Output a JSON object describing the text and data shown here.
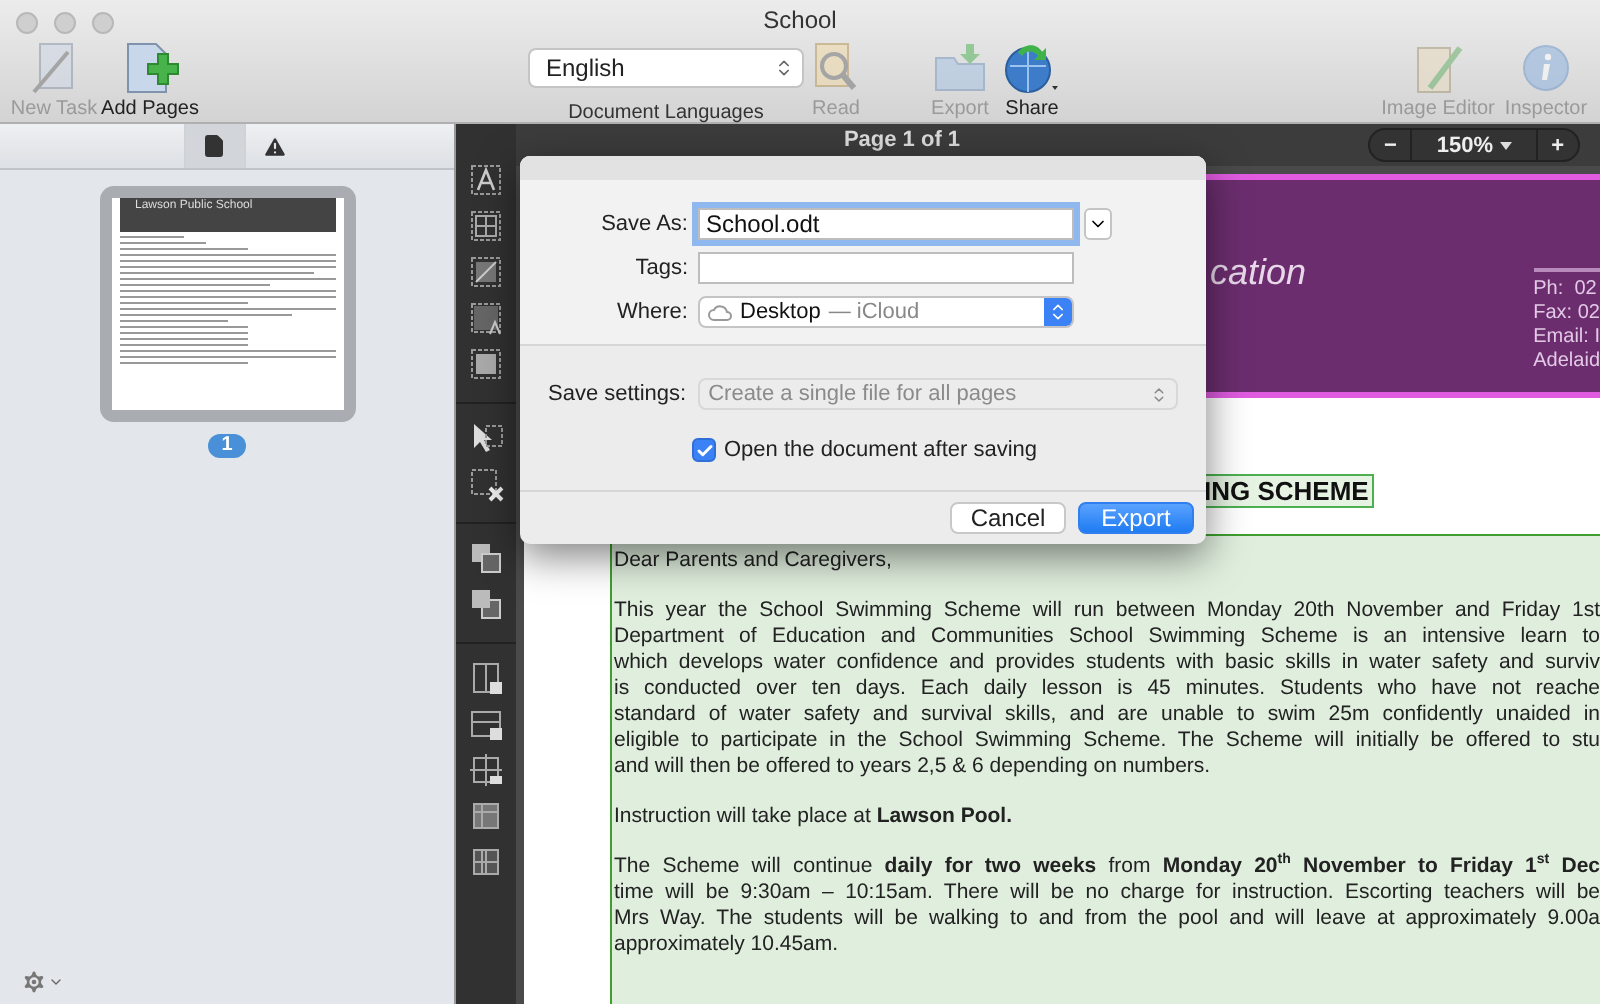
{
  "window": {
    "title": "School"
  },
  "toolbar": {
    "left": [
      {
        "label": "New Task",
        "kind": "wand",
        "disabled": true
      },
      {
        "label": "Add Pages",
        "kind": "add",
        "disabled": false
      }
    ],
    "language": {
      "value": "English",
      "label": "Document Languages"
    },
    "middle": [
      {
        "label": "Read",
        "kind": "read",
        "disabled": true
      },
      {
        "label": "Export",
        "kind": "export",
        "disabled": true
      },
      {
        "label": "Share",
        "kind": "share",
        "disabled": false
      }
    ],
    "right": [
      {
        "label": "Image Editor",
        "kind": "editor",
        "disabled": true
      },
      {
        "label": "Inspector",
        "kind": "info",
        "disabled": true
      }
    ]
  },
  "sidebar": {
    "tabs": [
      {
        "kind": "page",
        "selected": true
      },
      {
        "kind": "warning",
        "selected": false
      }
    ],
    "thumbnail": {
      "title": "Lawson Public School",
      "badge": "1",
      "selected": true
    }
  },
  "page_bar": {
    "label": "Page 1 of 1",
    "zoom": {
      "minus": "−",
      "value": "150%",
      "plus": "+"
    }
  },
  "dialog": {
    "save_as": {
      "label": "Save As:",
      "value": "School.odt",
      "focused": true
    },
    "tags": {
      "label": "Tags:"
    },
    "where": {
      "label": "Where:",
      "value": "Desktop",
      "location": "— iCloud"
    },
    "save_settings": {
      "label": "Save settings:",
      "value": "Create a single file for all pages",
      "disabled": true
    },
    "open_after": {
      "label": "Open the document after saving",
      "checked": true
    },
    "buttons": [
      {
        "label": "Cancel",
        "default": false
      },
      {
        "label": "Export",
        "default": true
      }
    ]
  },
  "document": {
    "header": {
      "title": "cation",
      "contact": [
        "Ph:  02",
        "Fax: 02",
        "Email: I",
        "Adelaid"
      ]
    },
    "heading": "ING SCHEME",
    "paragraphs": [
      {
        "lines": [
          "Dear Parents and Caregivers,"
        ]
      },
      {
        "lines": [
          "This year the School Swimming Scheme will run between Monday 20th November and Friday 1st",
          "Department of Education and Communities School Swimming Scheme is an intensive learn to",
          "which develops water confidence and provides students with basic skills in water safety and surviv",
          "is conducted over ten days. Each daily lesson is 45 minutes. Students who have not reache",
          "standard of water safety and survival skills, and are unable to swim 25m confidently unaided in",
          "eligible to participate in the School Swimming Scheme. The Scheme will initially be offered to stu",
          "and will then be offered to years 2,5 & 6 depending on numbers."
        ]
      },
      {
        "lines": [
          "Instruction will take place at **Lawson Pool.**"
        ]
      },
      {
        "lines": [
          "The Scheme will continue **daily for two weeks** from **Monday 20$^{th}$ November to Friday 1$^{st}$ Dec**",
          "time will be 9:30am – 10:15am. There will be no charge for instruction. Escorting teachers will be",
          "Mrs Way. The students will be walking to and from the pool and will leave at approximately 9.00a",
          "approximately 10.45am."
        ]
      }
    ]
  }
}
